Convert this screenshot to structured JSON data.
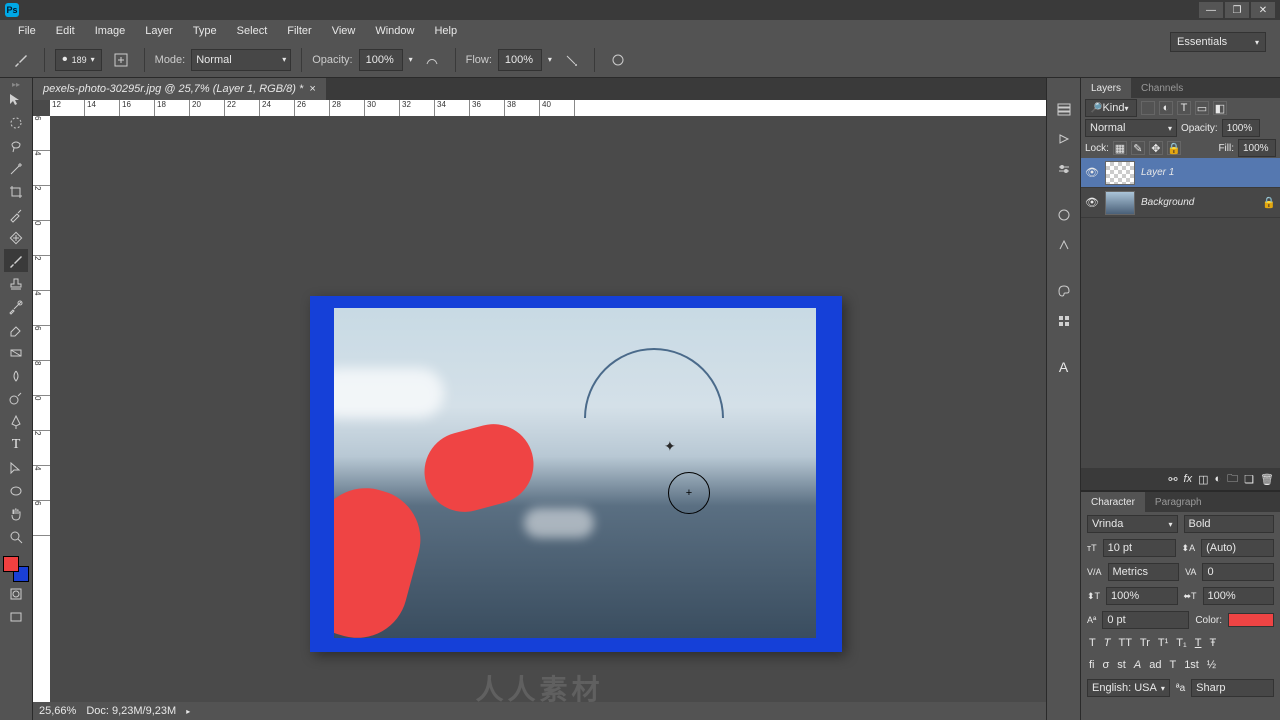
{
  "app": {
    "title": "Ps"
  },
  "menu": [
    "File",
    "Edit",
    "Image",
    "Layer",
    "Type",
    "Select",
    "Filter",
    "View",
    "Window",
    "Help"
  ],
  "options": {
    "brush_size": "189",
    "mode_label": "Mode:",
    "mode_value": "Normal",
    "opacity_label": "Opacity:",
    "opacity_value": "100%",
    "flow_label": "Flow:",
    "flow_value": "100%"
  },
  "workspace": "Essentials",
  "document": {
    "tab_title": "pexels-photo-30295r.jpg @ 25,7% (Layer 1, RGB/8) *",
    "zoom": "25,66%",
    "doc_size": "Doc: 9,23M/9,23M"
  },
  "ruler_h": [
    "12",
    "14",
    "16",
    "18",
    "20",
    "22",
    "24",
    "26",
    "28",
    "30",
    "32",
    "34",
    "36",
    "38",
    "40"
  ],
  "ruler_v": [
    "6",
    "4",
    "2",
    "0",
    "2",
    "4",
    "6",
    "8",
    "0",
    "2",
    "4",
    "6"
  ],
  "layers": {
    "tabs": [
      "Layers",
      "Channels"
    ],
    "kind": "Kind",
    "blend_mode": "Normal",
    "opacity_label": "Opacity:",
    "opacity_value": "100%",
    "lock_label": "Lock:",
    "fill_label": "Fill:",
    "fill_value": "100%",
    "items": [
      {
        "name": "Layer 1",
        "active": true,
        "checker": true
      },
      {
        "name": "Background",
        "active": false,
        "locked": true
      }
    ]
  },
  "character": {
    "tabs": [
      "Character",
      "Paragraph"
    ],
    "font": "Vrinda",
    "weight": "Bold",
    "size": "10 pt",
    "leading": "(Auto)",
    "tracking": "Metrics",
    "kerning": "0",
    "vscale": "100%",
    "hscale": "100%",
    "baseline": "0 pt",
    "color_label": "Color:",
    "language": "English: USA",
    "aa": "Sharp",
    "style_icons": [
      "T",
      "T",
      "TT",
      "Tr",
      "T¹",
      "T₁",
      "T",
      "Ŧ"
    ],
    "ot_icons": [
      "fi",
      "σ",
      "st",
      "A",
      "ad",
      "T",
      "1st",
      "½"
    ]
  },
  "colors": {
    "fg": "#f04040",
    "bg": "#1a3fd6"
  },
  "watermark": "人人素材"
}
